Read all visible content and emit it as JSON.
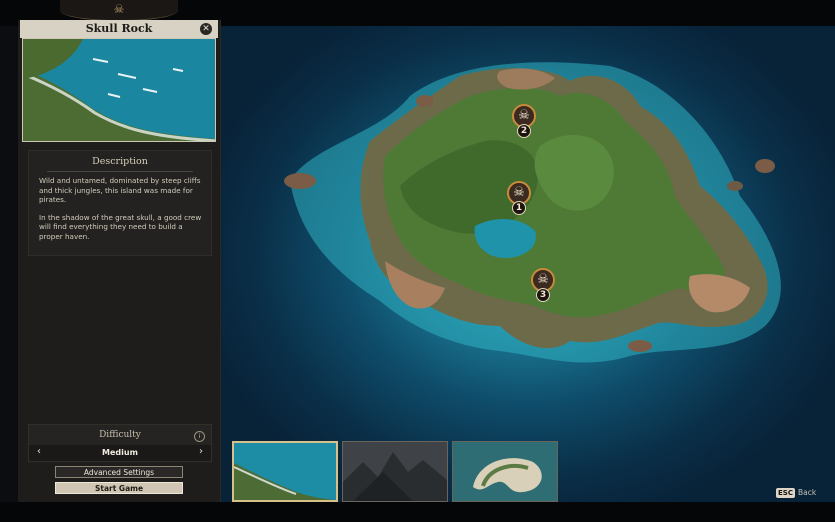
{
  "map": {
    "name": "Skull Rock",
    "close_icon": "close-icon",
    "description_title": "Description",
    "description_paragraphs": [
      "Wild and untamed, dominated by steep cliffs and thick jungles, this island was made for pirates.",
      "In the shadow of the great skull, a good crew will find everything they need to build a proper haven."
    ]
  },
  "markers": [
    {
      "number": "1",
      "icon": "skull-icon"
    },
    {
      "number": "2",
      "icon": "skull-icon"
    },
    {
      "number": "3",
      "icon": "skull-icon"
    }
  ],
  "difficulty": {
    "label": "Difficulty",
    "value": "Medium",
    "prev_icon": "chevron-left-icon",
    "next_icon": "chevron-right-icon",
    "info_icon": "info-icon"
  },
  "buttons": {
    "advanced": "Advanced Settings",
    "start": "Start Game"
  },
  "map_thumbnails": [
    {
      "selected": true
    },
    {
      "selected": false
    },
    {
      "selected": false
    }
  ],
  "footer": {
    "back_key": "ESC",
    "back_label": "Back"
  },
  "colors": {
    "accent": "#c98a3c",
    "ocean": "#1b7893",
    "panel": "#1e1d1c"
  }
}
